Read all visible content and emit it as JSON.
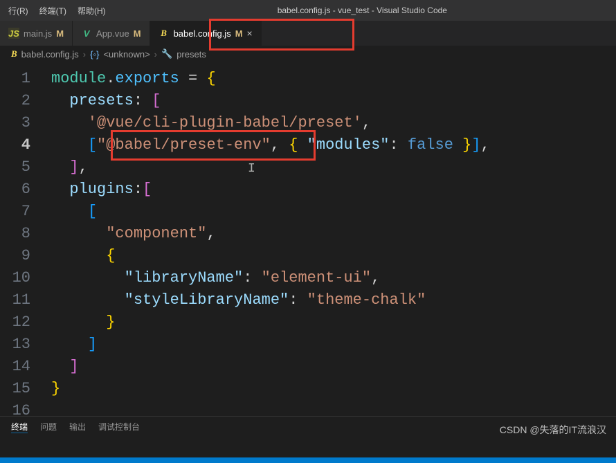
{
  "menubar": {
    "run": "行(R)",
    "terminal": "终端(T)",
    "help": "帮助(H)"
  },
  "title": "babel.config.js - vue_test - Visual Studio Code",
  "tabs": [
    {
      "name": "main.js",
      "status": "M",
      "active": false,
      "iconType": "js"
    },
    {
      "name": "App.vue",
      "status": "M",
      "active": false,
      "iconType": "vue"
    },
    {
      "name": "babel.config.js",
      "status": "M",
      "active": true,
      "iconType": "babel"
    }
  ],
  "breadcrumb": {
    "file": "babel.config.js",
    "scope": "<unknown>",
    "symbol": "presets"
  },
  "code": {
    "lines": [
      {
        "n": 1,
        "tokens": [
          [
            "module",
            "tok-kw"
          ],
          [
            ".",
            "tok-punct"
          ],
          [
            "exports",
            "tok-export"
          ],
          [
            " ",
            "tok-punct"
          ],
          [
            "=",
            "tok-punct"
          ],
          [
            " ",
            "tok-punct"
          ],
          [
            "{",
            "tok-bracket3"
          ]
        ]
      },
      {
        "n": 2,
        "tokens": [
          [
            "  presets",
            "tok-prop"
          ],
          [
            ":",
            "tok-punct"
          ],
          [
            " ",
            "tok-punct"
          ],
          [
            "[",
            "tok-bracket"
          ]
        ]
      },
      {
        "n": 3,
        "tokens": [
          [
            "    '@vue/cli-plugin-babel/preset'",
            "tok-str"
          ],
          [
            ",",
            "tok-punct"
          ]
        ]
      },
      {
        "n": 4,
        "current": true,
        "tokens": [
          [
            "    ",
            "tok-punct"
          ],
          [
            "[",
            "tok-bracket2"
          ],
          [
            "\"@babel/preset-env\"",
            "tok-str"
          ],
          [
            ",",
            "tok-punct"
          ],
          [
            " ",
            "tok-punct"
          ],
          [
            "{",
            "tok-bracket3"
          ],
          [
            " ",
            "tok-punct"
          ],
          [
            "\"modules\"",
            "tok-key"
          ],
          [
            ":",
            "tok-punct"
          ],
          [
            " ",
            "tok-punct"
          ],
          [
            "false",
            "tok-bool"
          ],
          [
            " ",
            "tok-punct"
          ],
          [
            "}",
            "tok-bracket3"
          ],
          [
            "]",
            "tok-bracket2"
          ],
          [
            ",",
            "tok-punct"
          ]
        ]
      },
      {
        "n": 5,
        "tokens": [
          [
            "  ",
            "tok-punct"
          ],
          [
            "]",
            "tok-bracket"
          ],
          [
            ",",
            "tok-punct"
          ]
        ]
      },
      {
        "n": 6,
        "tokens": [
          [
            "  plugins",
            "tok-prop"
          ],
          [
            ":",
            "tok-punct"
          ],
          [
            "[",
            "tok-bracket"
          ]
        ]
      },
      {
        "n": 7,
        "tokens": [
          [
            "    ",
            "tok-punct"
          ],
          [
            "[",
            "tok-bracket2"
          ]
        ]
      },
      {
        "n": 8,
        "tokens": [
          [
            "      \"component\"",
            "tok-str"
          ],
          [
            ",",
            "tok-punct"
          ]
        ]
      },
      {
        "n": 9,
        "tokens": [
          [
            "      ",
            "tok-punct"
          ],
          [
            "{",
            "tok-bracket3"
          ]
        ]
      },
      {
        "n": 10,
        "tokens": [
          [
            "        \"libraryName\"",
            "tok-key"
          ],
          [
            ":",
            "tok-punct"
          ],
          [
            " ",
            "tok-punct"
          ],
          [
            "\"element-ui\"",
            "tok-str"
          ],
          [
            ",",
            "tok-punct"
          ]
        ]
      },
      {
        "n": 11,
        "tokens": [
          [
            "        \"styleLibraryName\"",
            "tok-key"
          ],
          [
            ":",
            "tok-punct"
          ],
          [
            " ",
            "tok-punct"
          ],
          [
            "\"theme-chalk\"",
            "tok-str"
          ]
        ]
      },
      {
        "n": 12,
        "tokens": [
          [
            "      ",
            "tok-punct"
          ],
          [
            "}",
            "tok-bracket3"
          ]
        ]
      },
      {
        "n": 13,
        "tokens": [
          [
            "    ",
            "tok-punct"
          ],
          [
            "]",
            "tok-bracket2"
          ]
        ]
      },
      {
        "n": 14,
        "tokens": [
          [
            "  ",
            "tok-punct"
          ],
          [
            "]",
            "tok-bracket"
          ]
        ]
      },
      {
        "n": 15,
        "tokens": [
          [
            "}",
            "tok-bracket3"
          ]
        ]
      },
      {
        "n": 16,
        "tokens": [
          [
            "",
            ""
          ]
        ]
      }
    ]
  },
  "panel": {
    "terminal": "终端",
    "problems": "问题",
    "output": "输出",
    "debug": "调试控制台"
  },
  "watermark": "CSDN @失落的IT流浪汉"
}
